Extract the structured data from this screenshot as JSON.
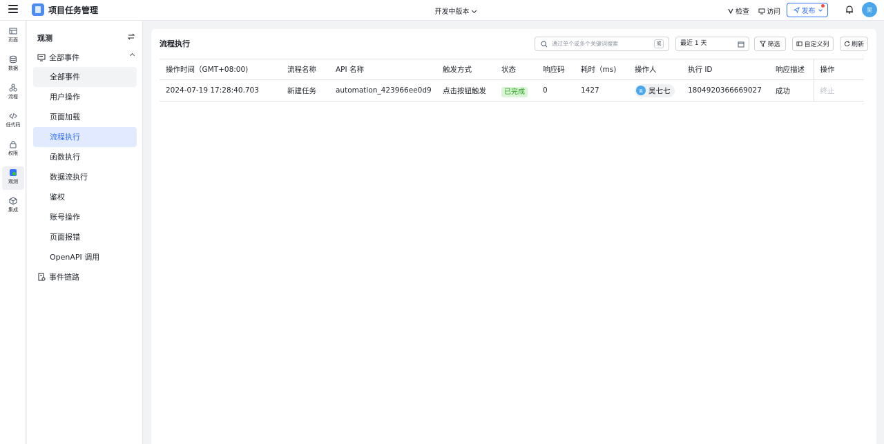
{
  "header": {
    "app_title": "项目任务管理",
    "version": "开发中版本",
    "check": "检查",
    "visit": "访问",
    "publish": "发布",
    "avatar": "吴"
  },
  "rail": [
    {
      "label": "页面",
      "icon": "page-icon"
    },
    {
      "label": "数据",
      "icon": "database-icon"
    },
    {
      "label": "流程",
      "icon": "flow-icon"
    },
    {
      "label": "低代码",
      "icon": "code-icon"
    },
    {
      "label": "权限",
      "icon": "lock-icon"
    },
    {
      "label": "观测",
      "icon": "observe-icon"
    },
    {
      "label": "集成",
      "icon": "cube-icon"
    }
  ],
  "sidebar": {
    "title": "观测",
    "group": "全部事件",
    "items": [
      "全部事件",
      "用户操作",
      "页面加载",
      "流程执行",
      "函数执行",
      "数据流执行",
      "鉴权",
      "账号操作",
      "页面报错",
      "OpenAPI 调用"
    ],
    "chain": "事件链路"
  },
  "main": {
    "title": "流程执行",
    "search_placeholder": "通过单个或多个关键词搜索",
    "search_or": "或",
    "range": "最近 1 天",
    "filter": "筛选",
    "custom_columns": "自定义列",
    "refresh": "刷新"
  },
  "table": {
    "columns": [
      "操作时间（GMT+08:00)",
      "流程名称",
      "API 名称",
      "触发方式",
      "状态",
      "响应码",
      "耗时（ms)",
      "操作人",
      "执行 ID",
      "响应描述",
      "操作"
    ],
    "rows": [
      {
        "time": "2024-07-19 17:28:40.703",
        "flow": "新建任务",
        "api": "automation_423966ee0d9",
        "trigger": "点击按钮触发",
        "status": "已完成",
        "code": "0",
        "duration": "1427",
        "operator": "吴七七",
        "operator_avatar": "吴",
        "exec_id": "1804920366669027",
        "desc": "成功",
        "action": "终止"
      }
    ]
  },
  "colors": {
    "accent": "#3370ff",
    "success_bg": "#d9f5d6",
    "success_fg": "#2ea121",
    "avatar": "#4aa7ec"
  }
}
